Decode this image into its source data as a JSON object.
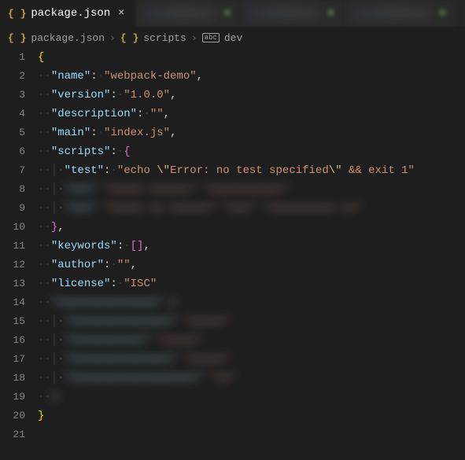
{
  "tabs": {
    "active": {
      "filename": "package.json"
    }
  },
  "breadcrumbs": {
    "file": "package.json",
    "section": "scripts",
    "item": "dev"
  },
  "editor": {
    "language": "json",
    "lines": {
      "total": 21,
      "l1": "{",
      "l2_key": "\"name\"",
      "l2_val": "\"webpack-demo\"",
      "l3_key": "\"version\"",
      "l3_val": "\"1.0.0\"",
      "l4_key": "\"description\"",
      "l4_val": "\"\"",
      "l5_key": "\"main\"",
      "l5_val": "\"index.js\"",
      "l6_key": "\"scripts\"",
      "l7_key": "\"test\"",
      "l7_val_a": "\"echo ",
      "l7_esc1": "\\\"",
      "l7_val_b": "Error: no test specified",
      "l7_esc2": "\\\"",
      "l7_val_c": " && exit 1\"",
      "l10": "}",
      "l11_key": "\"keywords\"",
      "l12_key": "\"author\"",
      "l12_val": "\"\"",
      "l13_key": "\"license\"",
      "l13_val": "\"ISC\"",
      "l20": "}"
    }
  },
  "icons": {
    "braces": "{ }",
    "close": "×",
    "chevron": "›",
    "abc": "abc"
  }
}
